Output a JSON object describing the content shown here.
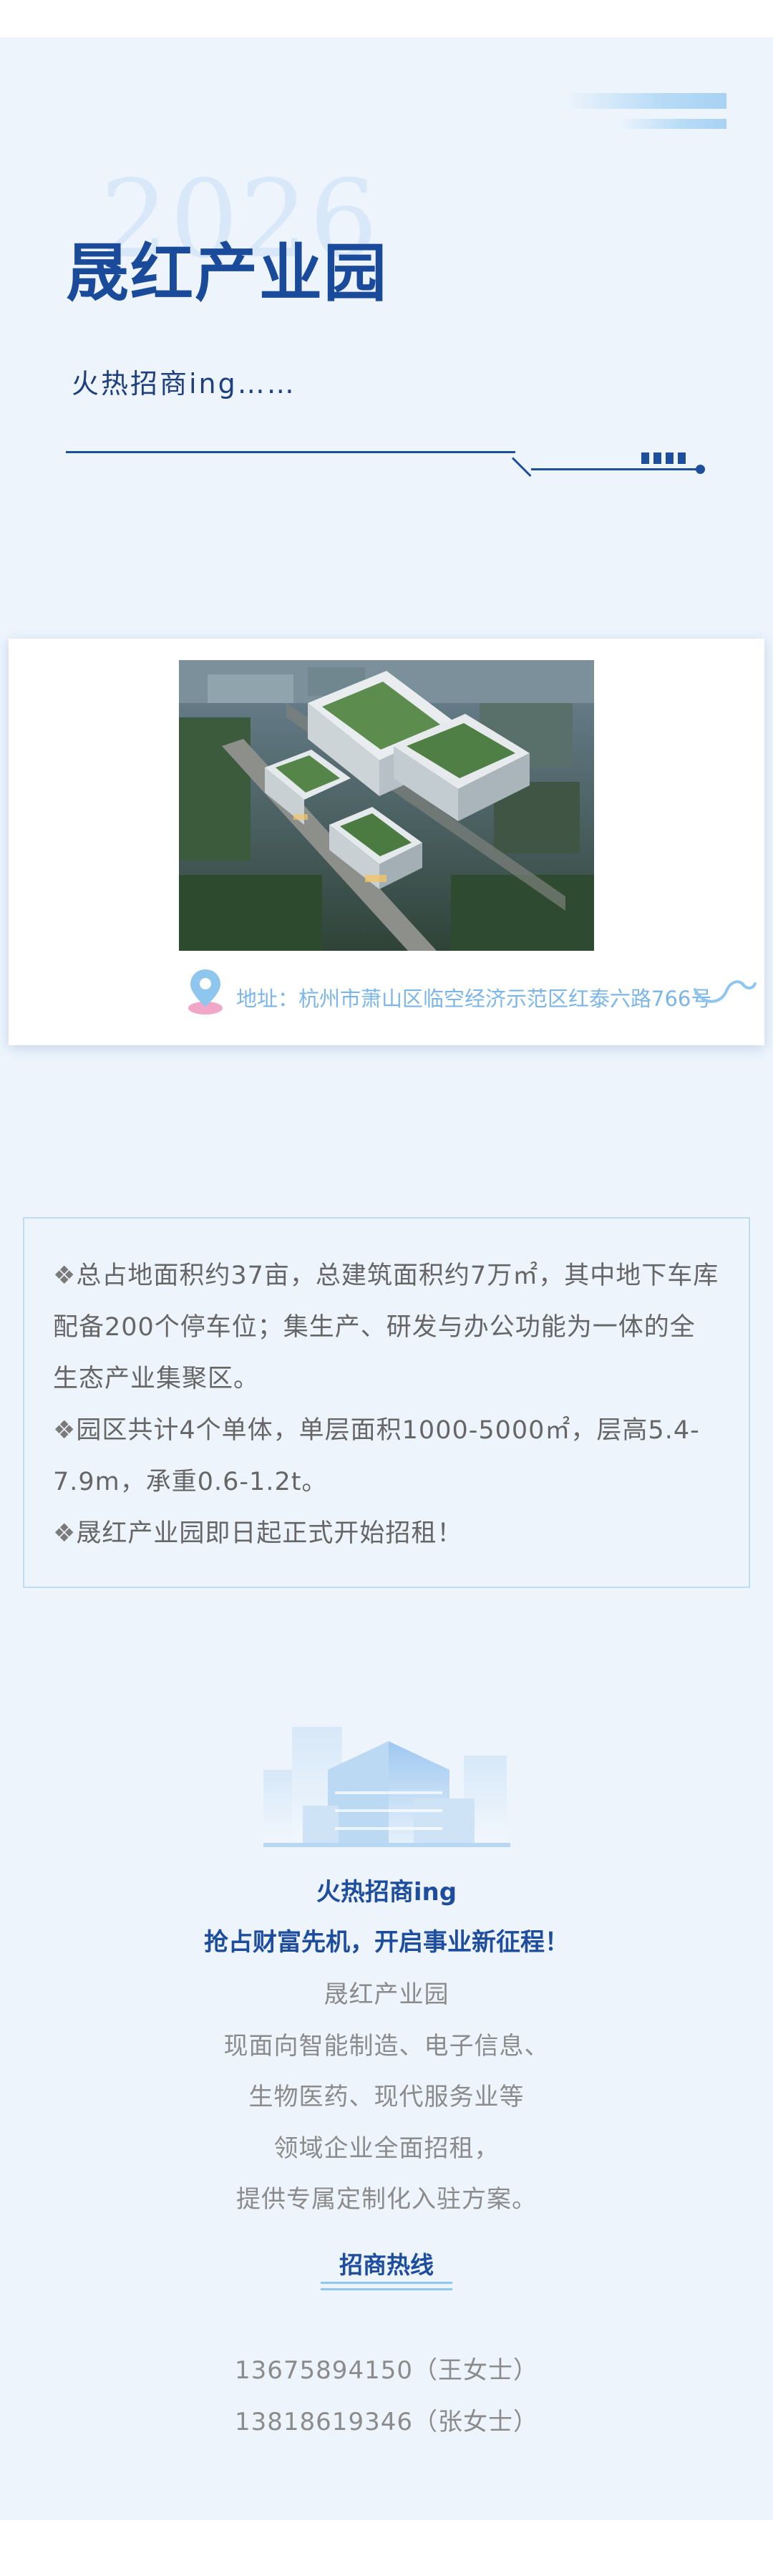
{
  "hero": {
    "year_watermark": "2026",
    "title": "晟红产业园",
    "subtitle": "火热招商ing……"
  },
  "photo_card": {
    "address": "地址：杭州市萧山区临空经济示范区红泰六路766号"
  },
  "info": {
    "bullet": "❖",
    "items": [
      "总占地面积约37亩，总建筑面积约7万㎡，其中地下车库配备200个停车位；集生产、研发与办公功能为一体的全生态产业集聚区。",
      "园区共计4个单体，单层面积1000-5000㎡，层高5.4-7.9m，承重0.6-1.2t。",
      "晟红产业园即日起正式开始招租！"
    ]
  },
  "promo": {
    "headline1": "火热招商ing",
    "headline2": "抢占财富先机，开启事业新征程！",
    "desc": [
      "晟红产业园",
      "现面向智能制造、电子信息、",
      "生物医药、现代服务业等",
      "领域企业全面招租，",
      "提供专属定制化入驻方案。"
    ],
    "hotline_label": "招商热线",
    "phones": [
      "13675894150（王女士）",
      "13818619346（张女士）"
    ]
  },
  "colors": {
    "page_bg": "#edf4fc",
    "brand_blue": "#1a4a9a",
    "light_blue": "#7cb6e8",
    "text_gray": "#8b8b8b"
  }
}
